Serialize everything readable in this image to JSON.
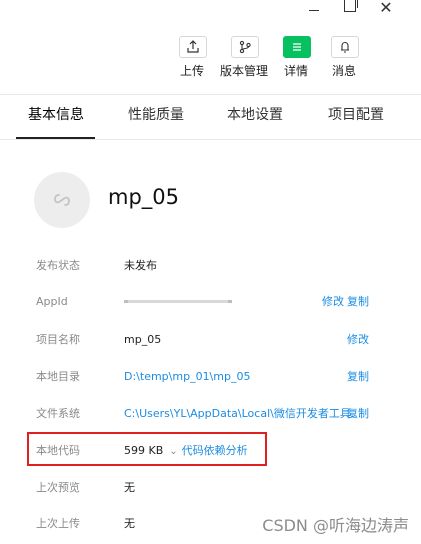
{
  "toolbar": {
    "upload_label": "上传",
    "version_label": "版本管理",
    "details_label": "详情",
    "messages_label": "消息"
  },
  "tabs": [
    "基本信息",
    "性能质量",
    "本地设置",
    "项目配置"
  ],
  "active_tab": 0,
  "project": {
    "name": "mp_05"
  },
  "info": {
    "publish_status": {
      "label": "发布状态",
      "value": "未发布"
    },
    "appid": {
      "label": "AppId",
      "actions": [
        "修改",
        "复制"
      ]
    },
    "project_name": {
      "label": "项目名称",
      "value": "mp_05",
      "action": "修改"
    },
    "local_dir": {
      "label": "本地目录",
      "value": "D:\\temp\\mp_01\\mp_05",
      "action": "复制"
    },
    "file_system": {
      "label": "文件系统",
      "value": "C:\\Users\\YL\\AppData\\Local\\微信开发者工具...",
      "action": "复制"
    },
    "local_code": {
      "label": "本地代码",
      "value": "599 KB",
      "action": "代码依赖分析"
    },
    "last_preview": {
      "label": "上次预览",
      "value": "无"
    },
    "last_upload": {
      "label": "上次上传",
      "value": "无"
    }
  },
  "watermark": "CSDN @听海边涛声",
  "colors": {
    "accent_green": "#07c160",
    "link_blue": "#1b8ce3",
    "highlight_red": "#e02020"
  }
}
